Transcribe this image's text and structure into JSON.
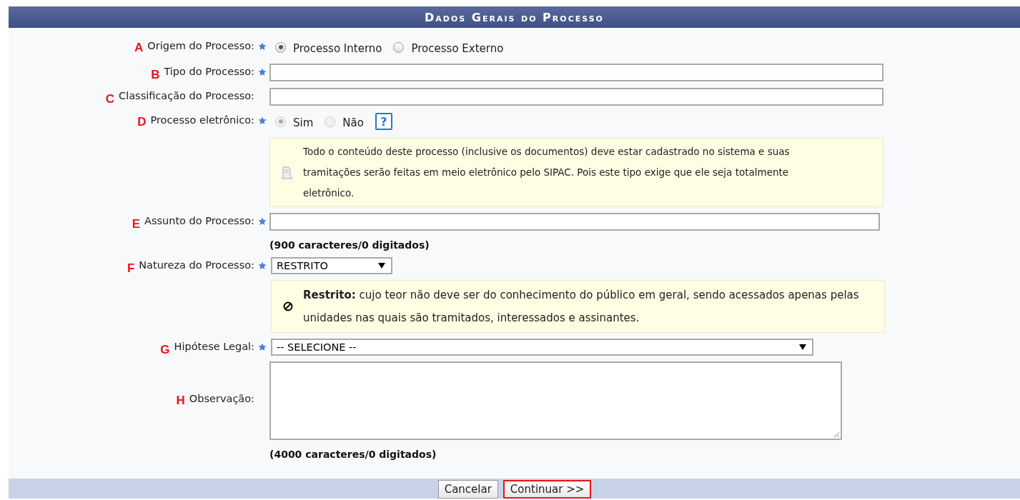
{
  "title": "Dados Gerais do Processo",
  "fields": [
    {
      "kind": "radio",
      "marker": "A",
      "label": "Origem do Processo:",
      "required": true,
      "disabled": false,
      "options": [
        {
          "label": "Processo Interno",
          "selected": true
        },
        {
          "label": "Processo Externo",
          "selected": false
        }
      ]
    },
    {
      "kind": "text",
      "marker": "B",
      "label": "Tipo do Processo:",
      "required": true
    },
    {
      "kind": "text",
      "marker": "C",
      "label": "Classificação do Processo:",
      "required": false
    },
    {
      "kind": "radio",
      "marker": "D",
      "label": "Processo eletrônico:",
      "required": true,
      "disabled": true,
      "help": "?",
      "options": [
        {
          "label": "Sim",
          "selected": true
        },
        {
          "label": "Não",
          "selected": false
        }
      ]
    },
    {
      "kind": "notice",
      "text": "Todo o conteúdo deste processo (inclusive os documentos) deve estar cadastrado no sistema e suas tramitações serão feitas em meio eletrônico pelo SIPAC. Pois este tipo exige que ele seja totalmente eletrônico."
    },
    {
      "kind": "text",
      "marker": "E",
      "label": "Assunto do Processo:",
      "required": true,
      "counter": "(900 caracteres/0 digitados)"
    },
    {
      "kind": "select",
      "marker": "F",
      "label": "Natureza do Processo:",
      "required": true,
      "value": "RESTRITO"
    },
    {
      "kind": "restriction",
      "text": "**Restrito:** cujo teor não deve ser do conhecimento do público em geral, sendo acessados apenas pelas unidades nas quais são tramitados, interessados e assinantes."
    },
    {
      "kind": "select",
      "marker": "G",
      "label": "Hipótese Legal:",
      "required": true,
      "value": "-- SELECIONE --"
    },
    {
      "kind": "textarea",
      "marker": "H",
      "label": "Observação:",
      "required": false,
      "counter": "(4000 caracteres/0 digitados)"
    }
  ],
  "buttons": [
    {
      "label": "Cancelar",
      "highlighted": false
    },
    {
      "label": "Continuar >>",
      "highlighted": true
    }
  ]
}
